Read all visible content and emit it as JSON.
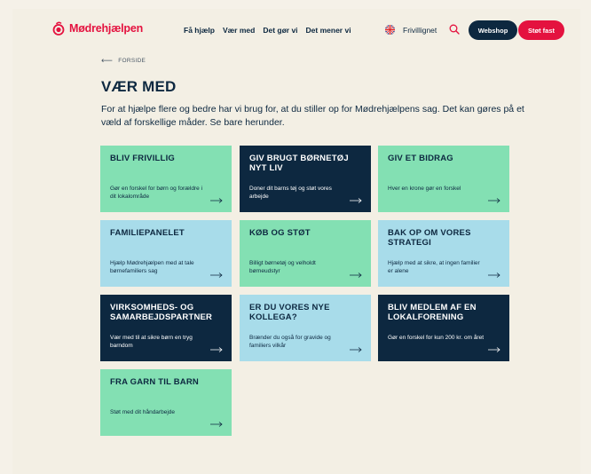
{
  "header": {
    "logo_text": "Mødrehjælpen",
    "nav": [
      "Få hjælp",
      "Vær med",
      "Det gør vi",
      "Det mener vi"
    ],
    "frivillignet": "Frivillignet",
    "webshop_label": "Webshop",
    "stot_fast_label": "Støt fast"
  },
  "colors": {
    "brand_red": "#e4123f",
    "navy": "#0d2840",
    "green": "#83e0b3",
    "light_blue": "#a8dcea",
    "background": "#f3efe4"
  },
  "breadcrumb": {
    "label": "FORSIDE"
  },
  "page_title": "VÆR MED",
  "intro": "For at hjælpe flere og bedre har vi brug for, at du stiller op for Mødrehjælpens sag. Det kan gøres på et væld af forskellige måder. Se bare herunder.",
  "cards": [
    {
      "title": "BLIV FRIVILLIG",
      "desc": "Gør en forskel for børn og forældre i dit lokalområde",
      "color": "green"
    },
    {
      "title": "GIV BRUGT BØRNETØJ NYT LIV",
      "desc": "Doner dit barns tøj og støt vores arbejde",
      "color": "navy"
    },
    {
      "title": "GIV ET BIDRAG",
      "desc": "Hver en krone gør en forskel",
      "color": "green"
    },
    {
      "title": "FAMILIEPANELET",
      "desc": "Hjælp Mødrehjælpen med at tale børnefamiliers sag",
      "color": "blue"
    },
    {
      "title": "KØB OG STØT",
      "desc": "Billigt børnetøj og velholdt børneudstyr",
      "color": "green"
    },
    {
      "title": "BAK OP OM VORES STRATEGI",
      "desc": "Hjælp med at sikre, at ingen familier er alene",
      "color": "blue"
    },
    {
      "title": "VIRKSOMHEDS- OG SAMARBEJDSPARTNER",
      "desc": "Vær med til at sikre børn en tryg barndom",
      "color": "navy"
    },
    {
      "title": "ER DU VORES NYE KOLLEGA?",
      "desc": "Brænder du også for gravide og familiers vilkår",
      "color": "blue"
    },
    {
      "title": "BLIV MEDLEM AF EN LOKALFORENING",
      "desc": "Gør en forskel for kun 200 kr. om året",
      "color": "navy"
    },
    {
      "title": "FRA GARN TIL BARN",
      "desc": "Støt med dit håndarbejde",
      "color": "green"
    }
  ]
}
